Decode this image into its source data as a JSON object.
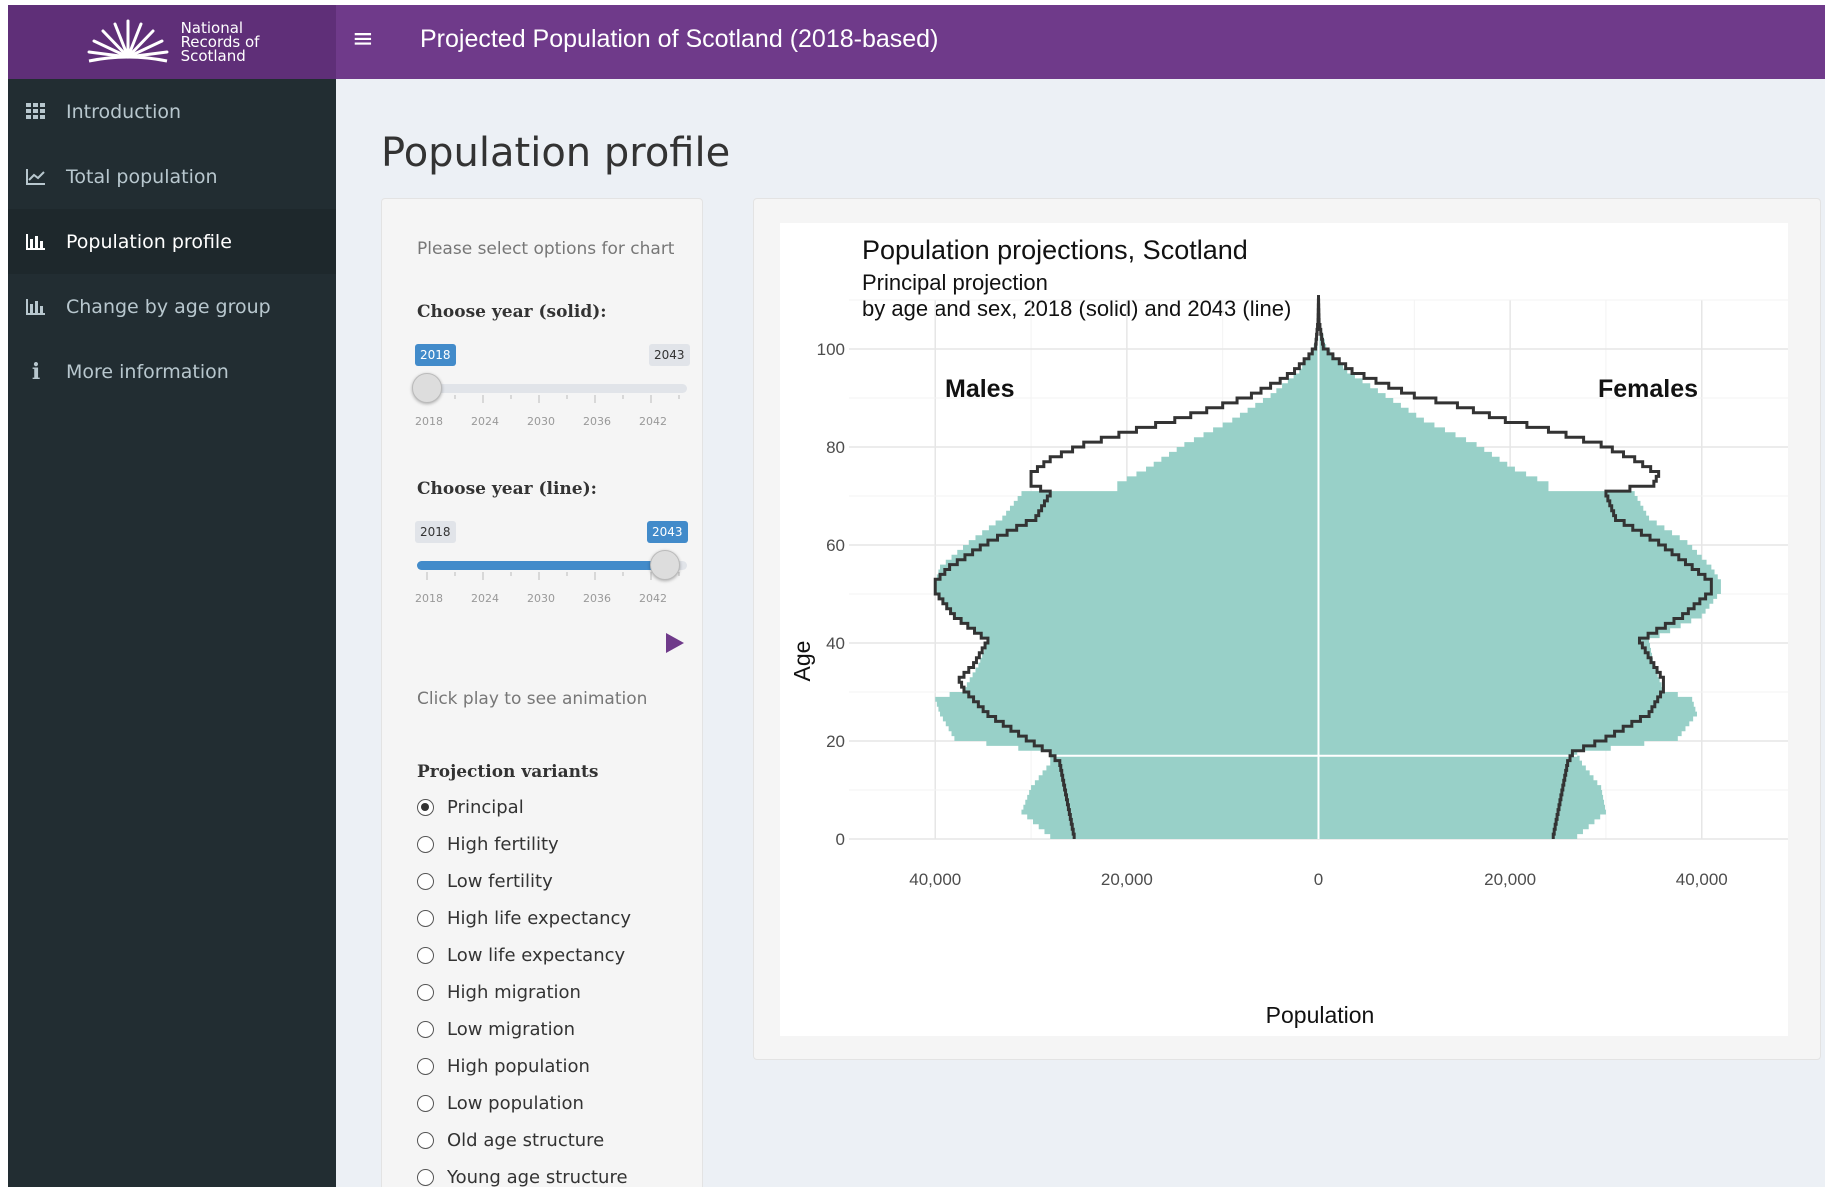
{
  "header": {
    "logo_lines": [
      "National",
      "Records of",
      "Scotland"
    ],
    "app_title": "Projected Population of Scotland (2018-based)",
    "menu_icon": "hamburger-icon"
  },
  "sidebar": {
    "items": [
      {
        "label": "Introduction",
        "icon": "grid-icon"
      },
      {
        "label": "Total population",
        "icon": "line-chart-icon"
      },
      {
        "label": "Population profile",
        "icon": "bar-chart-icon",
        "active": true
      },
      {
        "label": "Change by age group",
        "icon": "bar-chart-icon"
      },
      {
        "label": "More information",
        "icon": "info-icon"
      }
    ]
  },
  "main": {
    "page_title": "Population profile",
    "controls": {
      "intro": "Please select options for chart",
      "slider_solid": {
        "label": "Choose year (solid):",
        "value": "2018",
        "max_label": "2043",
        "ticks": [
          "2018",
          "2024",
          "2030",
          "2036",
          "2042"
        ]
      },
      "slider_line": {
        "label": "Choose year (line):",
        "min_label": "2018",
        "value": "2043",
        "ticks": [
          "2018",
          "2024",
          "2030",
          "2036",
          "2042"
        ]
      },
      "play_hint": "Click play to see animation",
      "variants_label": "Projection variants",
      "variants": [
        "Principal",
        "High fertility",
        "Low fertility",
        "High life expectancy",
        "Low life expectancy",
        "High migration",
        "Low migration",
        "High population",
        "Low population",
        "Old age structure",
        "Young age structure"
      ],
      "selected_variant": "Principal"
    }
  },
  "colors": {
    "header": "#6f3a8a",
    "sidebar": "#222d32",
    "bar_fill": "#98d0c8",
    "line": "#333333",
    "slider": "#428bca",
    "play": "#6f3a8a"
  },
  "chart_data": {
    "type": "population-pyramid",
    "title": "Population projections, Scotland",
    "subtitle_lines": [
      "Principal projection",
      "by age and sex, 2018 (solid) and 2043 (line)"
    ],
    "xlabel": "Population",
    "ylabel": "Age",
    "left_label": "Males",
    "right_label": "Females",
    "xlim": [
      -49000,
      49000
    ],
    "ylim": [
      0,
      110
    ],
    "x_ticks": [
      -40000,
      -20000,
      0,
      20000,
      40000
    ],
    "x_tick_labels": [
      "40,000",
      "20,000",
      "0",
      "20,000",
      "40,000"
    ],
    "y_ticks": [
      0,
      20,
      40,
      60,
      80,
      100
    ],
    "series": [
      {
        "name": "2018",
        "style": "solid",
        "ages": [
          0,
          5,
          10,
          15,
          17,
          20,
          25,
          28,
          30,
          35,
          40,
          45,
          50,
          52,
          55,
          60,
          65,
          70,
          71,
          72,
          75,
          80,
          85,
          90,
          95,
          100,
          105,
          110
        ],
        "males": [
          28000,
          31000,
          30000,
          28000,
          28000,
          38000,
          39500,
          40000,
          37000,
          35500,
          34500,
          38000,
          40000,
          40000,
          39500,
          36500,
          33000,
          31000,
          21000,
          21000,
          18000,
          14000,
          9000,
          5000,
          2000,
          500,
          80,
          0
        ],
        "females": [
          27000,
          30000,
          29500,
          27500,
          27000,
          37500,
          39500,
          39000,
          36000,
          35000,
          34500,
          40000,
          42000,
          42000,
          41000,
          38500,
          34500,
          33000,
          24000,
          24000,
          20500,
          16500,
          11000,
          7000,
          3000,
          800,
          100,
          0
        ]
      },
      {
        "name": "2043",
        "style": "line",
        "ages": [
          0,
          5,
          10,
          15,
          17,
          20,
          25,
          30,
          32,
          35,
          40,
          45,
          50,
          52,
          55,
          60,
          65,
          70,
          72,
          74,
          77,
          80,
          83,
          85,
          88,
          90,
          93,
          95,
          98,
          100,
          105,
          110
        ],
        "males": [
          25500,
          26000,
          26500,
          27000,
          28000,
          30500,
          34500,
          37000,
          37500,
          36000,
          34500,
          38000,
          40000,
          40000,
          38500,
          34500,
          29500,
          28000,
          30000,
          30000,
          28000,
          24500,
          19000,
          15000,
          10000,
          7000,
          4000,
          2500,
          1000,
          300,
          50,
          0
        ],
        "females": [
          24500,
          25000,
          25500,
          26000,
          26500,
          30000,
          34500,
          36000,
          36000,
          35000,
          33500,
          38000,
          41000,
          41000,
          39000,
          35500,
          31000,
          30000,
          35000,
          35500,
          33000,
          29500,
          24000,
          19500,
          14500,
          10000,
          6000,
          3500,
          1500,
          500,
          60,
          0
        ]
      }
    ]
  }
}
